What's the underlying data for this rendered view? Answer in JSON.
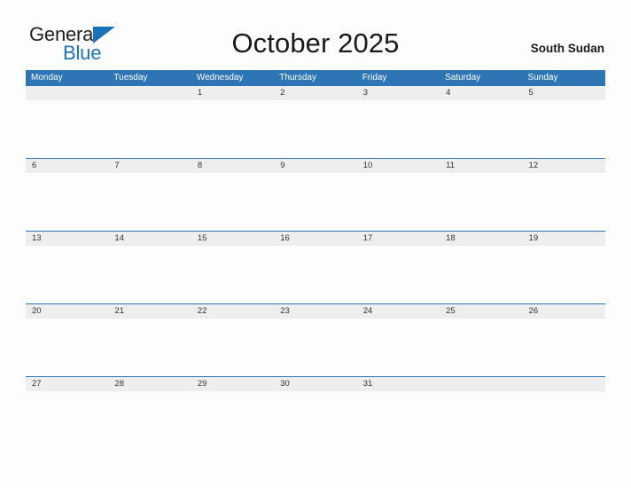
{
  "brand": {
    "name_part1": "General",
    "name_part2": "Blue",
    "triangle_color": "#1b72b8",
    "text_color_primary": "#231f20",
    "text_color_accent": "#1b72b8"
  },
  "header": {
    "title": "October 2025",
    "locale": "South Sudan"
  },
  "theme": {
    "header_blue": "#2e75b6",
    "date_band_grey": "#eeeeee",
    "page_background": "#fdfdfd",
    "date_text": "#333333"
  },
  "calendar": {
    "month": "October",
    "year": "2025",
    "first_day_of_week": "Monday",
    "weekdays": [
      {
        "label": "Monday"
      },
      {
        "label": "Tuesday"
      },
      {
        "label": "Wednesday"
      },
      {
        "label": "Thursday"
      },
      {
        "label": "Friday"
      },
      {
        "label": "Saturday"
      },
      {
        "label": "Sunday"
      }
    ],
    "weeks": [
      {
        "days": [
          {
            "date": ""
          },
          {
            "date": ""
          },
          {
            "date": "1"
          },
          {
            "date": "2"
          },
          {
            "date": "3"
          },
          {
            "date": "4"
          },
          {
            "date": "5"
          }
        ]
      },
      {
        "days": [
          {
            "date": "6"
          },
          {
            "date": "7"
          },
          {
            "date": "8"
          },
          {
            "date": "9"
          },
          {
            "date": "10"
          },
          {
            "date": "11"
          },
          {
            "date": "12"
          }
        ]
      },
      {
        "days": [
          {
            "date": "13"
          },
          {
            "date": "14"
          },
          {
            "date": "15"
          },
          {
            "date": "16"
          },
          {
            "date": "17"
          },
          {
            "date": "18"
          },
          {
            "date": "19"
          }
        ]
      },
      {
        "days": [
          {
            "date": "20"
          },
          {
            "date": "21"
          },
          {
            "date": "22"
          },
          {
            "date": "23"
          },
          {
            "date": "24"
          },
          {
            "date": "25"
          },
          {
            "date": "26"
          }
        ]
      },
      {
        "days": [
          {
            "date": "27"
          },
          {
            "date": "28"
          },
          {
            "date": "29"
          },
          {
            "date": "30"
          },
          {
            "date": "31"
          },
          {
            "date": ""
          },
          {
            "date": ""
          }
        ]
      }
    ]
  }
}
